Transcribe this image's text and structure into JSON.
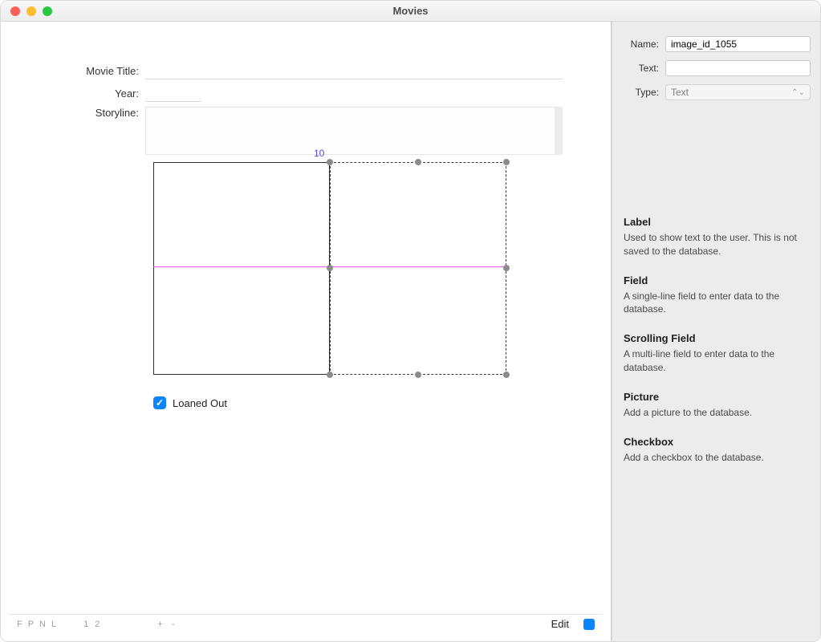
{
  "window": {
    "title": "Movies"
  },
  "form": {
    "movie_title_label": "Movie Title:",
    "year_label": "Year:",
    "storyline_label": "Storyline:",
    "loaned_out_label": "Loaned Out",
    "loaned_out_checked": true,
    "offset_value": "10"
  },
  "footer": {
    "tokens": "F  P  N  L",
    "page_1": "1",
    "page_2": "2",
    "plus_minus": "+  -",
    "edit_label": "Edit"
  },
  "inspector": {
    "name_label": "Name:",
    "name_value": "image_id_1055",
    "text_label": "Text:",
    "text_value": "",
    "type_label": "Type:",
    "type_value": "Text",
    "descriptions": [
      {
        "title": "Label",
        "body": "Used to show text to the user. This is not saved to the database."
      },
      {
        "title": "Field",
        "body": "A single-line field to enter data to the database."
      },
      {
        "title": "Scrolling Field",
        "body": "A multi-line field to enter data to the database."
      },
      {
        "title": "Picture",
        "body": "Add a picture to the database."
      },
      {
        "title": "Checkbox",
        "body": "Add a checkbox to the database."
      }
    ]
  }
}
